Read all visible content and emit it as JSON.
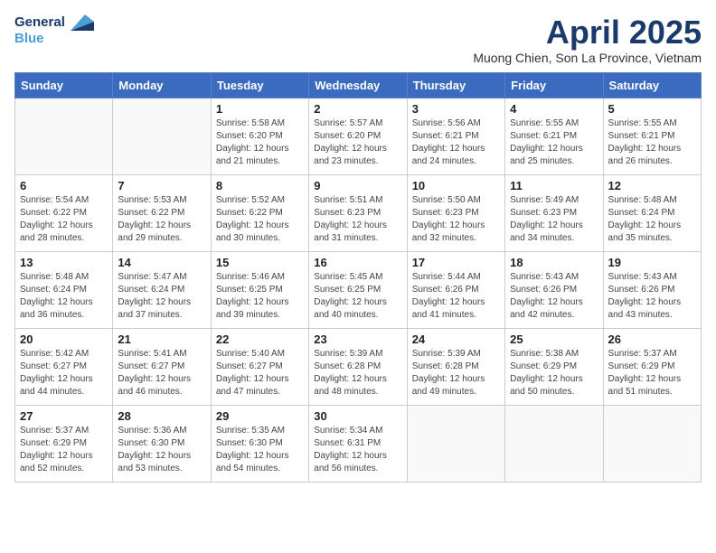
{
  "logo": {
    "line1": "General",
    "line2": "Blue",
    "icon": "▶"
  },
  "title": "April 2025",
  "subtitle": "Muong Chien, Son La Province, Vietnam",
  "headers": [
    "Sunday",
    "Monday",
    "Tuesday",
    "Wednesday",
    "Thursday",
    "Friday",
    "Saturday"
  ],
  "weeks": [
    [
      {
        "day": "",
        "info": ""
      },
      {
        "day": "",
        "info": ""
      },
      {
        "day": "1",
        "info": "Sunrise: 5:58 AM\nSunset: 6:20 PM\nDaylight: 12 hours and 21 minutes."
      },
      {
        "day": "2",
        "info": "Sunrise: 5:57 AM\nSunset: 6:20 PM\nDaylight: 12 hours and 23 minutes."
      },
      {
        "day": "3",
        "info": "Sunrise: 5:56 AM\nSunset: 6:21 PM\nDaylight: 12 hours and 24 minutes."
      },
      {
        "day": "4",
        "info": "Sunrise: 5:55 AM\nSunset: 6:21 PM\nDaylight: 12 hours and 25 minutes."
      },
      {
        "day": "5",
        "info": "Sunrise: 5:55 AM\nSunset: 6:21 PM\nDaylight: 12 hours and 26 minutes."
      }
    ],
    [
      {
        "day": "6",
        "info": "Sunrise: 5:54 AM\nSunset: 6:22 PM\nDaylight: 12 hours and 28 minutes."
      },
      {
        "day": "7",
        "info": "Sunrise: 5:53 AM\nSunset: 6:22 PM\nDaylight: 12 hours and 29 minutes."
      },
      {
        "day": "8",
        "info": "Sunrise: 5:52 AM\nSunset: 6:22 PM\nDaylight: 12 hours and 30 minutes."
      },
      {
        "day": "9",
        "info": "Sunrise: 5:51 AM\nSunset: 6:23 PM\nDaylight: 12 hours and 31 minutes."
      },
      {
        "day": "10",
        "info": "Sunrise: 5:50 AM\nSunset: 6:23 PM\nDaylight: 12 hours and 32 minutes."
      },
      {
        "day": "11",
        "info": "Sunrise: 5:49 AM\nSunset: 6:23 PM\nDaylight: 12 hours and 34 minutes."
      },
      {
        "day": "12",
        "info": "Sunrise: 5:48 AM\nSunset: 6:24 PM\nDaylight: 12 hours and 35 minutes."
      }
    ],
    [
      {
        "day": "13",
        "info": "Sunrise: 5:48 AM\nSunset: 6:24 PM\nDaylight: 12 hours and 36 minutes."
      },
      {
        "day": "14",
        "info": "Sunrise: 5:47 AM\nSunset: 6:24 PM\nDaylight: 12 hours and 37 minutes."
      },
      {
        "day": "15",
        "info": "Sunrise: 5:46 AM\nSunset: 6:25 PM\nDaylight: 12 hours and 39 minutes."
      },
      {
        "day": "16",
        "info": "Sunrise: 5:45 AM\nSunset: 6:25 PM\nDaylight: 12 hours and 40 minutes."
      },
      {
        "day": "17",
        "info": "Sunrise: 5:44 AM\nSunset: 6:26 PM\nDaylight: 12 hours and 41 minutes."
      },
      {
        "day": "18",
        "info": "Sunrise: 5:43 AM\nSunset: 6:26 PM\nDaylight: 12 hours and 42 minutes."
      },
      {
        "day": "19",
        "info": "Sunrise: 5:43 AM\nSunset: 6:26 PM\nDaylight: 12 hours and 43 minutes."
      }
    ],
    [
      {
        "day": "20",
        "info": "Sunrise: 5:42 AM\nSunset: 6:27 PM\nDaylight: 12 hours and 44 minutes."
      },
      {
        "day": "21",
        "info": "Sunrise: 5:41 AM\nSunset: 6:27 PM\nDaylight: 12 hours and 46 minutes."
      },
      {
        "day": "22",
        "info": "Sunrise: 5:40 AM\nSunset: 6:27 PM\nDaylight: 12 hours and 47 minutes."
      },
      {
        "day": "23",
        "info": "Sunrise: 5:39 AM\nSunset: 6:28 PM\nDaylight: 12 hours and 48 minutes."
      },
      {
        "day": "24",
        "info": "Sunrise: 5:39 AM\nSunset: 6:28 PM\nDaylight: 12 hours and 49 minutes."
      },
      {
        "day": "25",
        "info": "Sunrise: 5:38 AM\nSunset: 6:29 PM\nDaylight: 12 hours and 50 minutes."
      },
      {
        "day": "26",
        "info": "Sunrise: 5:37 AM\nSunset: 6:29 PM\nDaylight: 12 hours and 51 minutes."
      }
    ],
    [
      {
        "day": "27",
        "info": "Sunrise: 5:37 AM\nSunset: 6:29 PM\nDaylight: 12 hours and 52 minutes."
      },
      {
        "day": "28",
        "info": "Sunrise: 5:36 AM\nSunset: 6:30 PM\nDaylight: 12 hours and 53 minutes."
      },
      {
        "day": "29",
        "info": "Sunrise: 5:35 AM\nSunset: 6:30 PM\nDaylight: 12 hours and 54 minutes."
      },
      {
        "day": "30",
        "info": "Sunrise: 5:34 AM\nSunset: 6:31 PM\nDaylight: 12 hours and 56 minutes."
      },
      {
        "day": "",
        "info": ""
      },
      {
        "day": "",
        "info": ""
      },
      {
        "day": "",
        "info": ""
      }
    ]
  ]
}
